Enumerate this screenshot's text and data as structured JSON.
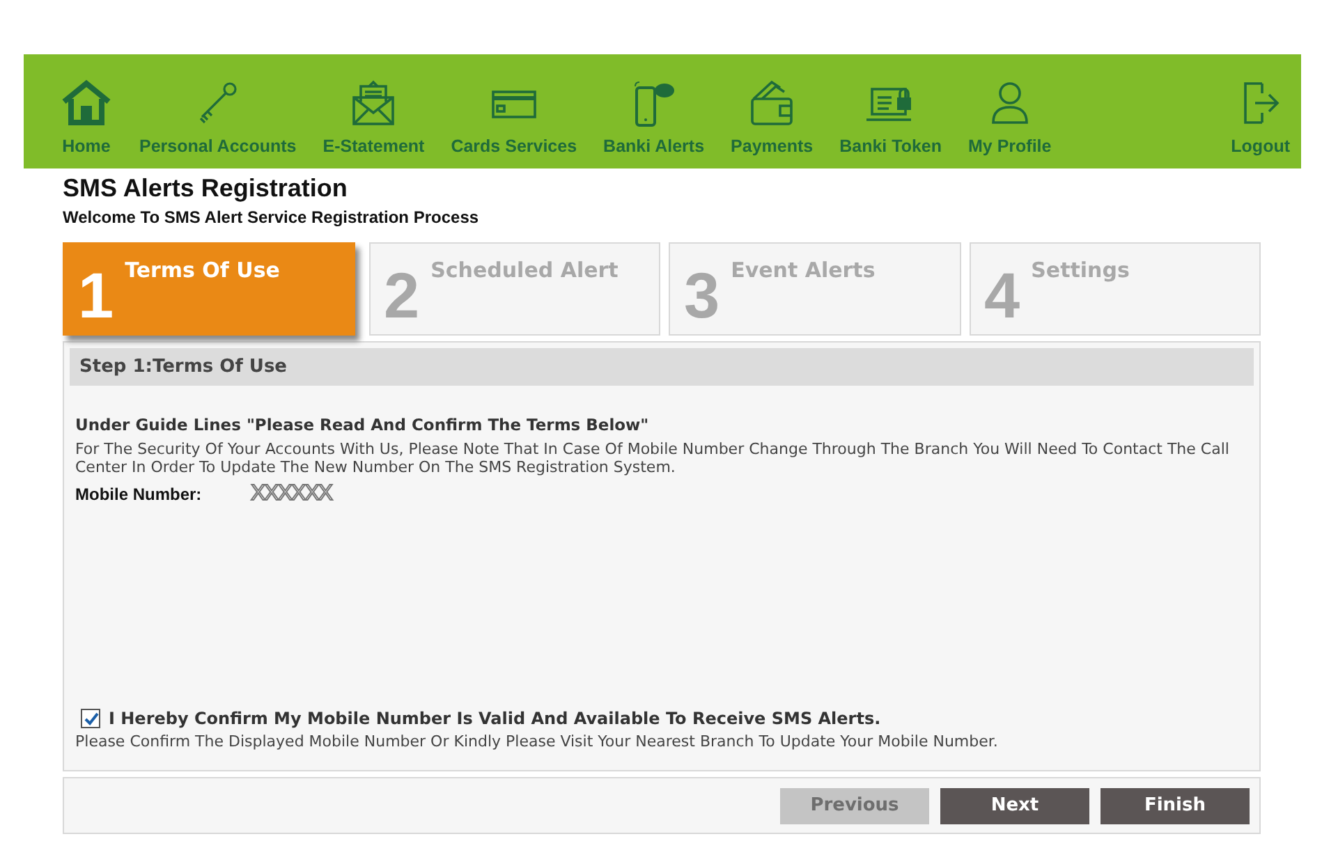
{
  "nav": {
    "items": [
      {
        "label": "Home"
      },
      {
        "label": "Personal Accounts"
      },
      {
        "label": "E-Statement"
      },
      {
        "label": "Cards Services"
      },
      {
        "label": "Banki Alerts"
      },
      {
        "label": "Payments"
      },
      {
        "label": "Banki Token"
      },
      {
        "label": "My Profile"
      }
    ],
    "logout": {
      "label": "Logout"
    }
  },
  "page": {
    "title": "SMS Alerts Registration",
    "subtitle": "Welcome To SMS Alert Service Registration Process"
  },
  "steps": [
    {
      "number": "1",
      "label": "Terms Of Use",
      "selected": true
    },
    {
      "number": "2",
      "label": "Scheduled Alert",
      "selected": false
    },
    {
      "number": "3",
      "label": "Event Alerts",
      "selected": false
    },
    {
      "number": "4",
      "label": "Settings",
      "selected": false
    }
  ],
  "panel": {
    "header": "Step 1:Terms Of Use",
    "heading": "Under Guide Lines \"Please Read And Confirm The Terms Below\"",
    "body": "For The Security Of Your Accounts With Us, Please Note That In Case Of Mobile Number Change Through The Branch You Will Need To Contact The Call Center In Order To Update The New Number On The SMS Registration System.",
    "mobile_label": "Mobile Number:",
    "mobile_value": "XXXXXX",
    "confirm": {
      "label": "I Hereby Confirm My Mobile Number Is Valid And Available To Receive SMS Alerts.",
      "checked": true
    },
    "note": "Please Confirm The Displayed Mobile Number Or Kindly Please Visit Your Nearest Branch To Update Your Mobile Number."
  },
  "buttons": [
    {
      "label": "Previous",
      "disabled": true
    },
    {
      "label": "Next",
      "disabled": false
    },
    {
      "label": "Finish",
      "disabled": false
    }
  ]
}
